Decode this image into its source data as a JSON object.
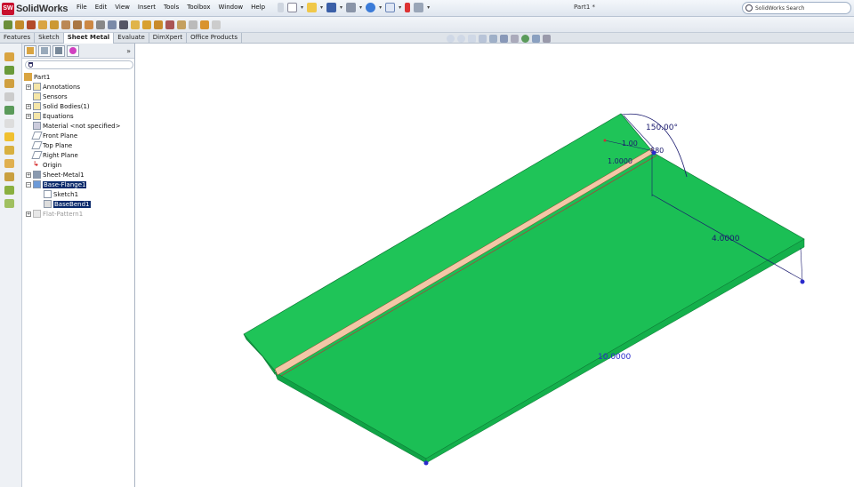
{
  "app": {
    "name": "SolidWorks",
    "logo_text": "SW"
  },
  "menu": [
    "File",
    "Edit",
    "View",
    "Insert",
    "Tools",
    "Toolbox",
    "Window",
    "Help"
  ],
  "document_title": "Part1 *",
  "search": {
    "placeholder": "SolidWorks Search"
  },
  "command_tabs": [
    {
      "label": "Features",
      "active": false
    },
    {
      "label": "Sketch",
      "active": false
    },
    {
      "label": "Sheet Metal",
      "active": true
    },
    {
      "label": "Evaluate",
      "active": false
    },
    {
      "label": "DimXpert",
      "active": false
    },
    {
      "label": "Office Products",
      "active": false
    }
  ],
  "feature_tree": {
    "root": "Part1",
    "items": [
      {
        "label": "Annotations",
        "icon": "annotations-icon",
        "expandable": true
      },
      {
        "label": "Sensors",
        "icon": "sensors-icon",
        "expandable": false
      },
      {
        "label": "Solid Bodies(1)",
        "icon": "solid-bodies-icon",
        "expandable": true
      },
      {
        "label": "Equations",
        "icon": "equations-icon",
        "expandable": true
      },
      {
        "label": "Material <not specified>",
        "icon": "material-icon",
        "expandable": false
      },
      {
        "label": "Front Plane",
        "icon": "plane-icon",
        "expandable": false
      },
      {
        "label": "Top Plane",
        "icon": "plane-icon",
        "expandable": false
      },
      {
        "label": "Right Plane",
        "icon": "plane-icon",
        "expandable": false
      },
      {
        "label": "Origin",
        "icon": "origin-icon",
        "expandable": false
      },
      {
        "label": "Sheet-Metal1",
        "icon": "sheet-metal-icon",
        "expandable": true
      },
      {
        "label": "Base-Flange1",
        "icon": "base-flange-icon",
        "expandable": true,
        "selected": true
      },
      {
        "label": "Sketch1",
        "icon": "sketch-icon",
        "expandable": false,
        "child": true
      },
      {
        "label": "BaseBend1",
        "icon": "base-bend-icon",
        "expandable": false,
        "child": true,
        "selected": true
      },
      {
        "label": "Flat-Pattern1",
        "icon": "flat-pattern-icon",
        "expandable": true,
        "dimmed": true
      }
    ]
  },
  "dimensions": {
    "angle": "150.00°",
    "radius_a": "1.00",
    "radius_b": "880",
    "thickness": "1.0000",
    "width": "4.0000",
    "length": "10.0000"
  },
  "colors": {
    "part_face": "#1bbf55",
    "part_edge": "#0d7a35",
    "bend_face": "#f3c7a6",
    "dimension": "#1a1a6e",
    "selection": "#0a2a6b"
  }
}
